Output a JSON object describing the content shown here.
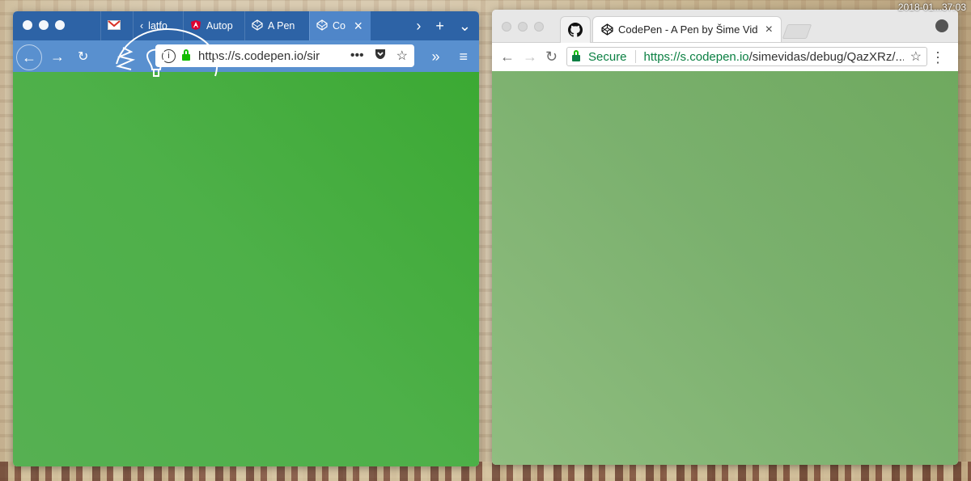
{
  "desktop": {
    "clock": "2018-01...37:03"
  },
  "firefox": {
    "tabs": [
      {
        "label": "",
        "icon": "gmail-icon"
      },
      {
        "label": "latfo",
        "icon": "back-arrow-icon"
      },
      {
        "label": "Autop",
        "icon": "angular-icon"
      },
      {
        "label": "A Pen",
        "icon": "codepen-icon"
      },
      {
        "label": "Co",
        "icon": "codepen-icon",
        "active": true
      }
    ],
    "address_bar": {
      "url_display": "https://s.codepen.io/sir",
      "more_label": "•••"
    }
  },
  "chrome": {
    "tab": {
      "title": "CodePen - A Pen by Šime Vidas",
      "icon": "codepen-icon"
    },
    "omnibox": {
      "security_label": "Secure",
      "url_base": "https://s.codepen.io",
      "url_path": "/simevidas/debug/QazXRz/..."
    }
  },
  "colors": {
    "firefox_page_green": "#3ba933",
    "chrome_page_green": "#7ab06d",
    "firefox_tabbar": "#2d63a6",
    "firefox_navbar": "#5990cf"
  }
}
